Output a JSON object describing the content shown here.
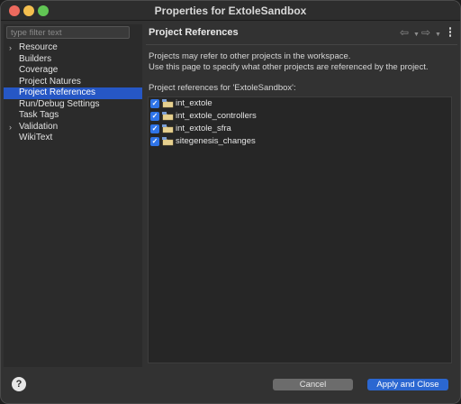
{
  "window": {
    "title": "Properties for ExtoleSandbox"
  },
  "sidebar": {
    "filter_placeholder": "type filter text",
    "items": [
      {
        "label": "Resource",
        "expandable": true,
        "selected": false
      },
      {
        "label": "Builders",
        "expandable": false,
        "selected": false
      },
      {
        "label": "Coverage",
        "expandable": false,
        "selected": false
      },
      {
        "label": "Project Natures",
        "expandable": false,
        "selected": false
      },
      {
        "label": "Project References",
        "expandable": false,
        "selected": true
      },
      {
        "label": "Run/Debug Settings",
        "expandable": false,
        "selected": false
      },
      {
        "label": "Task Tags",
        "expandable": false,
        "selected": false
      },
      {
        "label": "Validation",
        "expandable": true,
        "selected": false
      },
      {
        "label": "WikiText",
        "expandable": false,
        "selected": false
      }
    ]
  },
  "main": {
    "title": "Project References",
    "description_lines": [
      "Projects may refer to other projects in the workspace.",
      "Use this page to specify what other projects are referenced by the project."
    ],
    "list_label": "Project references for 'ExtoleSandbox':",
    "references": [
      {
        "label": "int_extole",
        "checked": true
      },
      {
        "label": "int_extole_controllers",
        "checked": true
      },
      {
        "label": "int_extole_sfra",
        "checked": true
      },
      {
        "label": "sitegenesis_changes",
        "checked": true
      }
    ]
  },
  "footer": {
    "cancel_label": "Cancel",
    "apply_close_label": "Apply and Close"
  },
  "icons": {
    "back": "back-arrow-icon",
    "forward": "forward-arrow-icon",
    "menu": "vertical-dots-icon",
    "help": "help-icon",
    "folder": "project-folder-icon"
  },
  "colors": {
    "selection": "#2657c5",
    "checkbox": "#2f74e8",
    "primary_button": "#2b67d1"
  }
}
